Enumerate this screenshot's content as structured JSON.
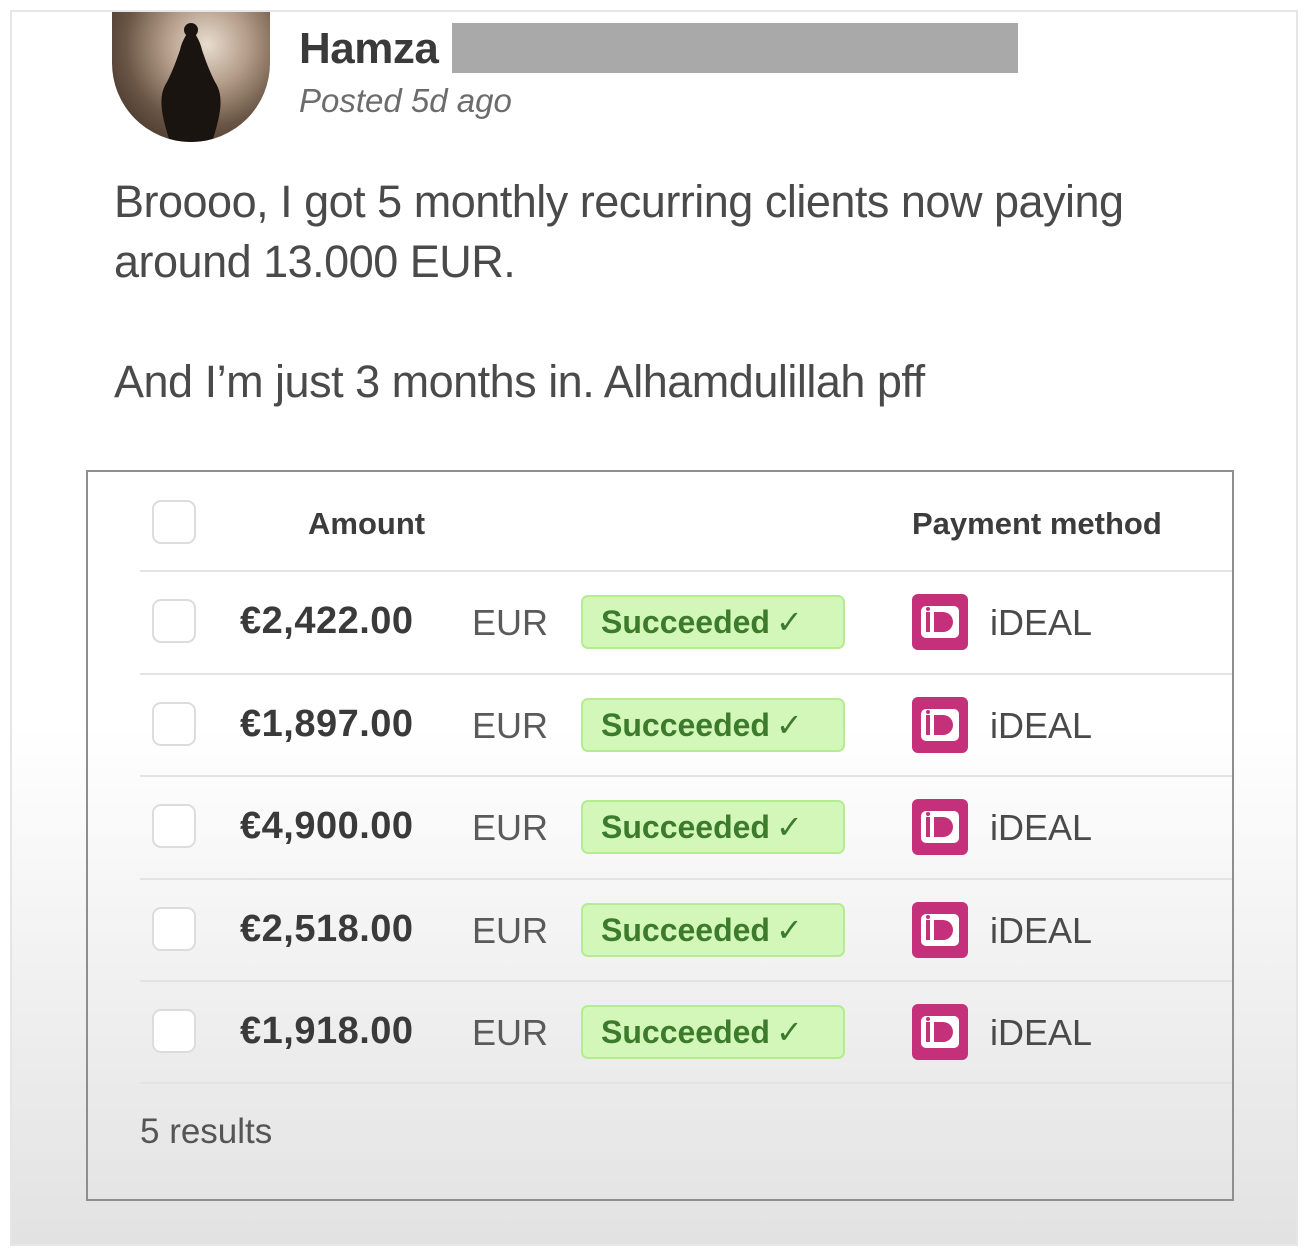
{
  "post": {
    "author": "Hamza",
    "posted": "Posted 5d ago",
    "paragraphs": [
      "Broooo, I got 5 monthly recurring clients now paying around 13.000 EUR.",
      "And I’m just 3 months in. Alhamdulillah pff"
    ]
  },
  "payments": {
    "headers": {
      "amount": "Amount",
      "method": "Payment method"
    },
    "rows": [
      {
        "amount": "€2,422.00",
        "currency": "EUR",
        "status": "Succeeded",
        "status_icon": "✓",
        "method": "iDEAL"
      },
      {
        "amount": "€1,897.00",
        "currency": "EUR",
        "status": "Succeeded",
        "status_icon": "✓",
        "method": "iDEAL"
      },
      {
        "amount": "€4,900.00",
        "currency": "EUR",
        "status": "Succeeded",
        "status_icon": "✓",
        "method": "iDEAL"
      },
      {
        "amount": "€2,518.00",
        "currency": "EUR",
        "status": "Succeeded",
        "status_icon": "✓",
        "method": "iDEAL"
      },
      {
        "amount": "€1,918.00",
        "currency": "EUR",
        "status": "Succeeded",
        "status_icon": "✓",
        "method": "iDEAL"
      }
    ],
    "results": "5 results"
  },
  "colors": {
    "status_bg": "#d2f7b8",
    "status_text": "#3c7a2c",
    "ideal_brand": "#c4307a"
  },
  "icons": {
    "avatar": "profile-photo",
    "status": "check-icon",
    "method": "ideal-logo-icon"
  }
}
